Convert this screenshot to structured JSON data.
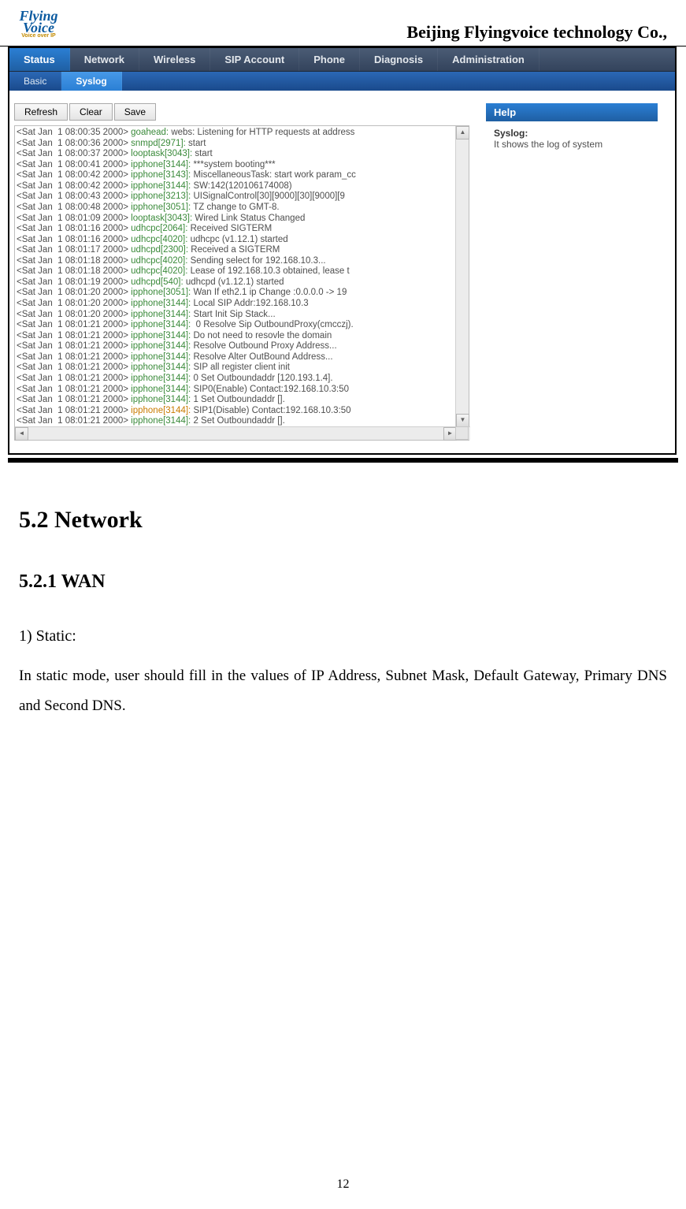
{
  "header": {
    "logo": {
      "line1": "Flying",
      "line2": "Voice",
      "sub": "Voice over IP"
    },
    "company": "Beijing Flyingvoice technology Co.,"
  },
  "tabs": {
    "main": [
      "Status",
      "Network",
      "Wireless",
      "SIP Account",
      "Phone",
      "Diagnosis",
      "Administration"
    ],
    "main_active_index": 0,
    "sub": [
      "Basic",
      "Syslog"
    ],
    "sub_active_index": 1
  },
  "buttons": {
    "refresh": "Refresh",
    "clear": "Clear",
    "save": "Save"
  },
  "help": {
    "title": "Help",
    "label": "Syslog:",
    "text": "It shows the log of system"
  },
  "syslog": [
    {
      "ts": "<Sat Jan  1 08:00:35 2000>",
      "srcClass": "src-green",
      "src": "goahead:",
      "msg": " webs: Listening for HTTP requests at address"
    },
    {
      "ts": "<Sat Jan  1 08:00:36 2000>",
      "srcClass": "src-green",
      "src": "snmpd[2971]:",
      "msg": " start"
    },
    {
      "ts": "<Sat Jan  1 08:00:37 2000>",
      "srcClass": "src-green",
      "src": "looptask[3043]:",
      "msg": " start"
    },
    {
      "ts": "<Sat Jan  1 08:00:41 2000>",
      "srcClass": "src-green",
      "src": "ipphone[3144]:",
      "msg": " ***system booting***"
    },
    {
      "ts": "<Sat Jan  1 08:00:42 2000>",
      "srcClass": "src-green",
      "src": "ipphone[3143]:",
      "msg": " MiscellaneousTask: start work param_cc"
    },
    {
      "ts": "<Sat Jan  1 08:00:42 2000>",
      "srcClass": "src-green",
      "src": "ipphone[3144]:",
      "msg": " SW:142(120106174008)"
    },
    {
      "ts": "<Sat Jan  1 08:00:43 2000>",
      "srcClass": "src-green",
      "src": "ipphone[3213]:",
      "msg": " UISignalControl[30][9000][30][9000][9"
    },
    {
      "ts": "<Sat Jan  1 08:00:48 2000>",
      "srcClass": "src-green",
      "src": "ipphone[3051]:",
      "msg": " TZ change to GMT-8."
    },
    {
      "ts": "<Sat Jan  1 08:01:09 2000>",
      "srcClass": "src-green",
      "src": "looptask[3043]:",
      "msg": " Wired Link Status Changed"
    },
    {
      "ts": "<Sat Jan  1 08:01:16 2000>",
      "srcClass": "src-green",
      "src": "udhcpc[2064]:",
      "msg": " Received SIGTERM"
    },
    {
      "ts": "<Sat Jan  1 08:01:16 2000>",
      "srcClass": "src-green",
      "src": "udhcpc[4020]:",
      "msg": " udhcpc (v1.12.1) started"
    },
    {
      "ts": "<Sat Jan  1 08:01:17 2000>",
      "srcClass": "src-green",
      "src": "udhcpd[2300]:",
      "msg": " Received a SIGTERM"
    },
    {
      "ts": "<Sat Jan  1 08:01:18 2000>",
      "srcClass": "src-green",
      "src": "udhcpc[4020]:",
      "msg": " Sending select for 192.168.10.3..."
    },
    {
      "ts": "<Sat Jan  1 08:01:18 2000>",
      "srcClass": "src-green",
      "src": "udhcpc[4020]:",
      "msg": " Lease of 192.168.10.3 obtained, lease t"
    },
    {
      "ts": "<Sat Jan  1 08:01:19 2000>",
      "srcClass": "src-green",
      "src": "udhcpd[540]:",
      "msg": " udhcpd (v1.12.1) started"
    },
    {
      "ts": "<Sat Jan  1 08:01:20 2000>",
      "srcClass": "src-green",
      "src": "ipphone[3051]:",
      "msg": " Wan If eth2.1 ip Change :0.0.0.0 -> 19"
    },
    {
      "ts": "<Sat Jan  1 08:01:20 2000>",
      "srcClass": "src-green",
      "src": "ipphone[3144]:",
      "msg": " Local SIP Addr:192.168.10.3"
    },
    {
      "ts": "<Sat Jan  1 08:01:20 2000>",
      "srcClass": "src-green",
      "src": "ipphone[3144]:",
      "msg": " Start Init Sip Stack..."
    },
    {
      "ts": "<Sat Jan  1 08:01:21 2000>",
      "srcClass": "src-green",
      "src": "ipphone[3144]:",
      "msg": "  0 Resolve Sip OutboundProxy(cmcczj)."
    },
    {
      "ts": "<Sat Jan  1 08:01:21 2000>",
      "srcClass": "src-green",
      "src": "ipphone[3144]:",
      "msg": " Do not need to resovle the domain"
    },
    {
      "ts": "<Sat Jan  1 08:01:21 2000>",
      "srcClass": "src-green",
      "src": "ipphone[3144]:",
      "msg": " Resolve Outbound Proxy Address..."
    },
    {
      "ts": "<Sat Jan  1 08:01:21 2000>",
      "srcClass": "src-green",
      "src": "ipphone[3144]:",
      "msg": " Resolve Alter OutBound Address..."
    },
    {
      "ts": "<Sat Jan  1 08:01:21 2000>",
      "srcClass": "src-green",
      "src": "ipphone[3144]:",
      "msg": " SIP all register client init"
    },
    {
      "ts": "<Sat Jan  1 08:01:21 2000>",
      "srcClass": "src-green",
      "src": "ipphone[3144]:",
      "msg": " 0 Set Outboundaddr [120.193.1.4]."
    },
    {
      "ts": "<Sat Jan  1 08:01:21 2000>",
      "srcClass": "src-green",
      "src": "ipphone[3144]:",
      "msg": " SIP0(Enable) Contact:192.168.10.3:50"
    },
    {
      "ts": "<Sat Jan  1 08:01:21 2000>",
      "srcClass": "src-green",
      "src": "ipphone[3144]:",
      "msg": " 1 Set Outboundaddr []."
    },
    {
      "ts": "<Sat Jan  1 08:01:21 2000>",
      "srcClass": "src-orange",
      "src": "ipphone[3144]:",
      "msg": " SIP1(Disable) Contact:192.168.10.3:50"
    },
    {
      "ts": "<Sat Jan  1 08:01:21 2000>",
      "srcClass": "src-green",
      "src": "ipphone[3144]:",
      "msg": " 2 Set Outboundaddr []."
    }
  ],
  "doc": {
    "h2": "5.2 Network",
    "h3": "5.2.1 WAN",
    "h4": "1) Static:",
    "para": "In static mode, user should fill in the values of IP Address, Subnet Mask, Default Gateway, Primary DNS and Second DNS.",
    "page": "12"
  }
}
